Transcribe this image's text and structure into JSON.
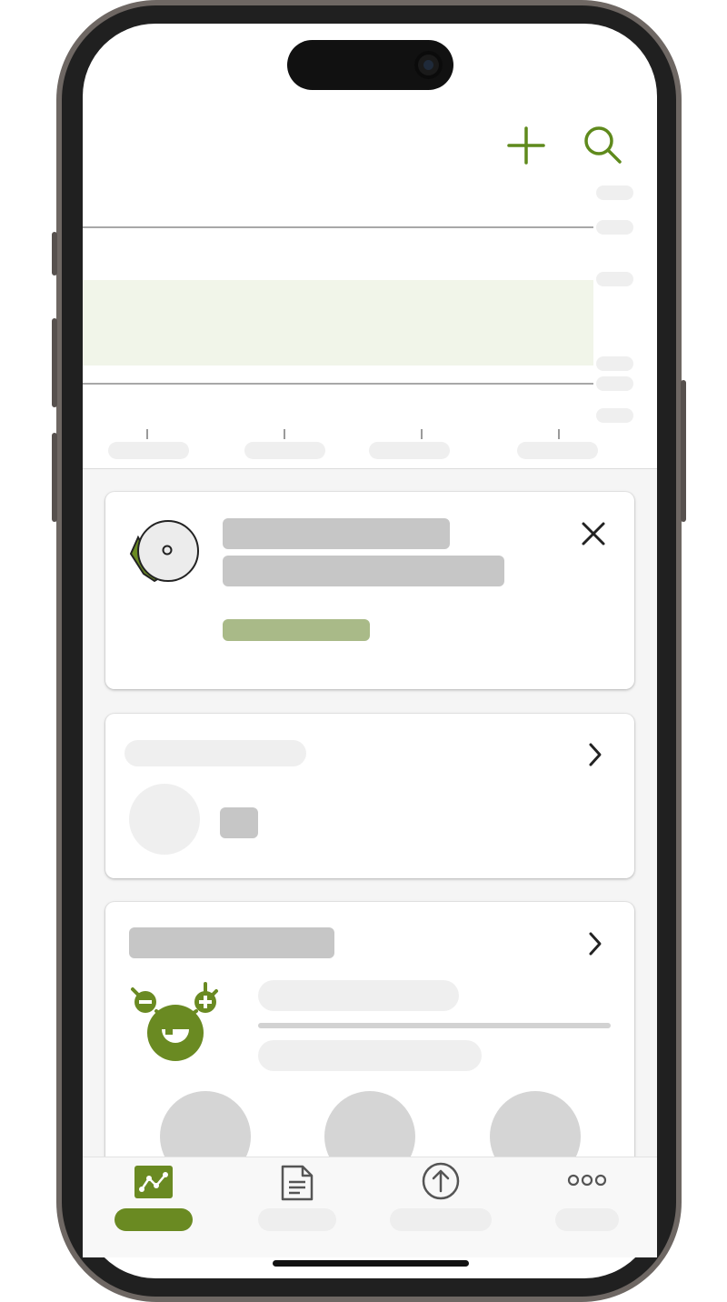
{
  "header": {
    "add_icon": "plus-icon",
    "search_icon": "magnifier-icon",
    "accent_color": "#5f8a1c"
  },
  "chart": {
    "state": "loading-placeholder",
    "target_band_color": "#f1f5e9"
  },
  "cards": [
    {
      "type": "sensor-notification",
      "icon": "sensor-icon",
      "close_icon": "close-icon"
    },
    {
      "type": "summary",
      "chevron_icon": "chevron-right-icon"
    },
    {
      "type": "challenge",
      "icon": "mascot-icon",
      "chevron_icon": "chevron-right-icon"
    }
  ],
  "tabbar": {
    "tabs": [
      {
        "icon": "chart-icon",
        "active": true
      },
      {
        "icon": "document-icon",
        "active": false
      },
      {
        "icon": "upload-icon",
        "active": false
      },
      {
        "icon": "more-icon",
        "active": false
      }
    ],
    "active_color": "#6a8a22"
  }
}
